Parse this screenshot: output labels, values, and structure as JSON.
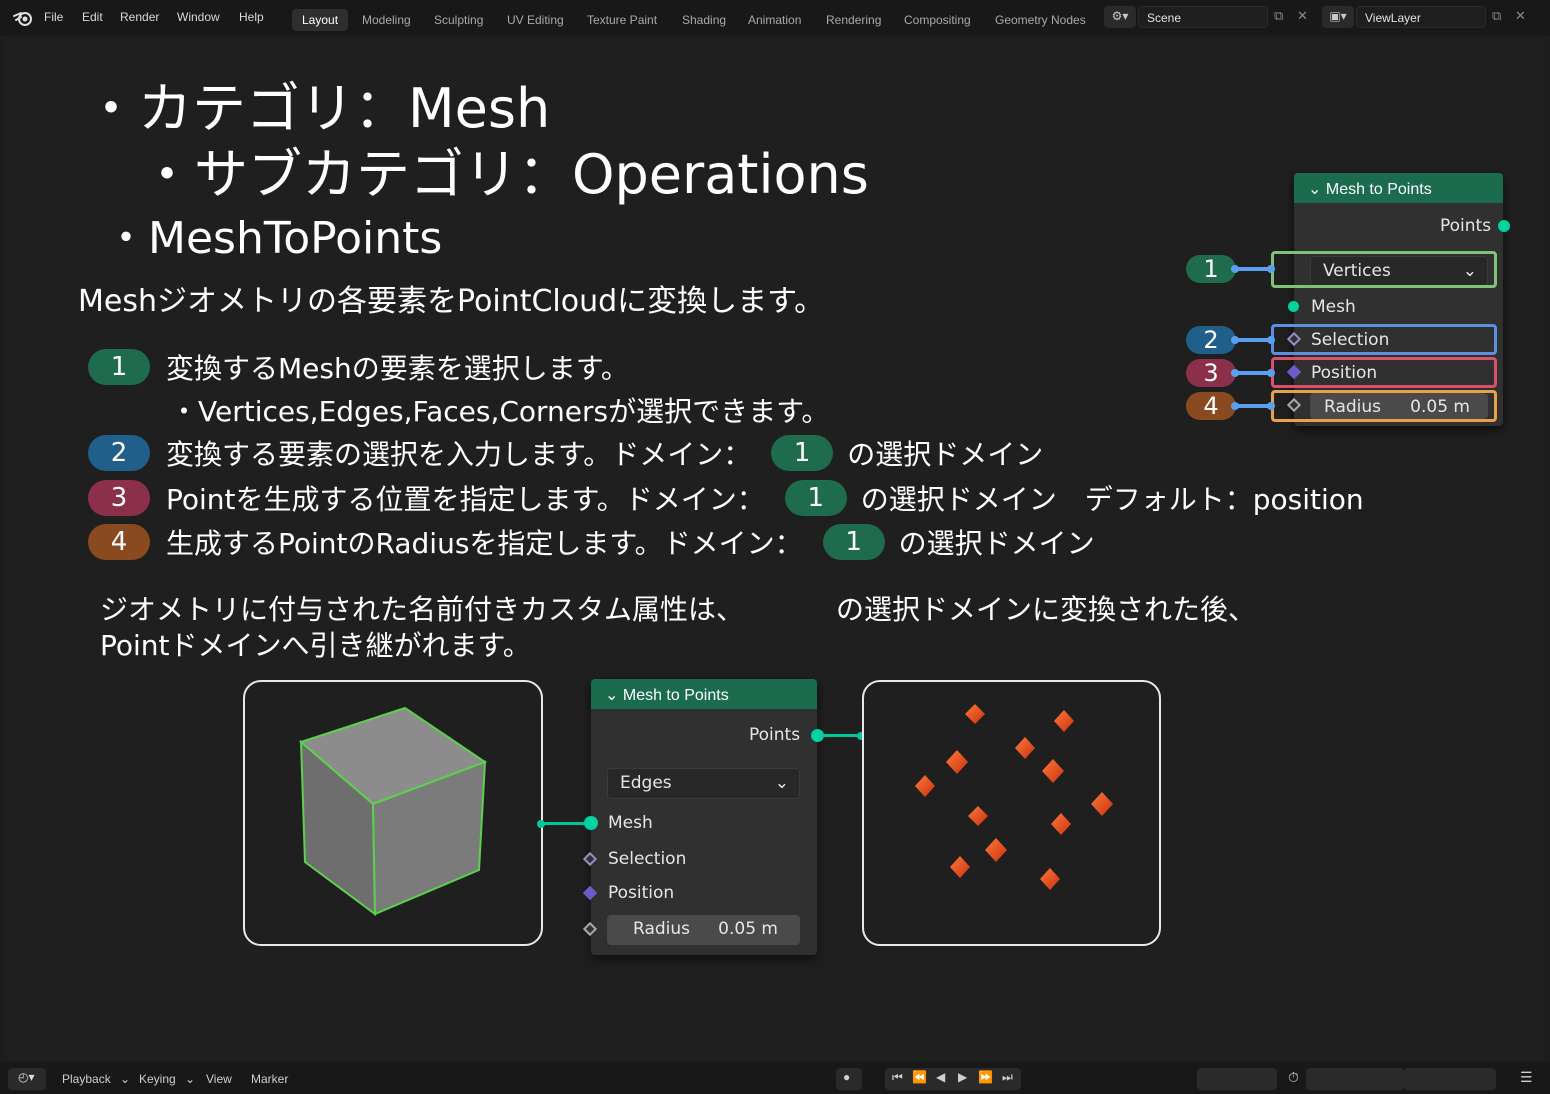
{
  "menu": {
    "items": [
      "File",
      "Edit",
      "Render",
      "Window",
      "Help"
    ]
  },
  "workspaces": {
    "tabs": [
      "Layout",
      "Modeling",
      "Sculpting",
      "UV Editing",
      "Texture Paint",
      "Shading",
      "Animation",
      "Rendering",
      "Compositing",
      "Geometry Nodes"
    ],
    "active": "Layout"
  },
  "scene": {
    "name": "Scene"
  },
  "view_layer": {
    "name": "ViewLayer"
  },
  "slide": {
    "category": "・カテゴリ：Mesh",
    "subcategory": "・サブカテゴリ：Operations",
    "node_name": "・MeshToPoints",
    "description": "Meshジオメトリの各要素をPointCloudに変換します。",
    "items": [
      {
        "num": "1",
        "text": "変換するMeshの要素を選択します。"
      },
      {
        "num": "2",
        "text": "変換する要素の選択を入力します。ドメイン：",
        "ref": "1",
        "suffix": "の選択ドメイン"
      },
      {
        "num": "3",
        "text": "Pointを生成する位置を指定します。ドメイン：",
        "ref": "1",
        "suffix": "の選択ドメイン　デフォルト：position"
      },
      {
        "num": "4",
        "text": "生成するPointのRadiusを指定します。ドメイン：",
        "ref": "1",
        "suffix": "の選択ドメイン"
      }
    ],
    "item1_sub": "・Vertices,Edges,Faces,Cornersが選択できます。",
    "note_line1a": "ジオメトリに付与された名前付きカスタム属性は、",
    "note_line1b": "の選択ドメインに変換された後、",
    "note_line2": "Pointドメインへ引き継がれます。"
  },
  "node_top": {
    "title": "Mesh to Points",
    "output": "Points",
    "mode": "Vertices",
    "inputs": [
      "Mesh",
      "Selection",
      "Position",
      "Radius"
    ],
    "radius_value": "0.05 m",
    "badges": [
      "1",
      "2",
      "3",
      "4"
    ]
  },
  "node_bottom": {
    "title": "Mesh to Points",
    "output": "Points",
    "mode": "Edges",
    "inputs": [
      "Mesh",
      "Selection",
      "Position",
      "Radius"
    ],
    "radius_value": "0.05 m"
  },
  "colors": {
    "badge1": "#1f6b4d",
    "badge2": "#1f5f8a",
    "badge3": "#8c2f4a",
    "badge4": "#8a4a1f",
    "node_header": "#1b6b4e",
    "socket_geometry": "#00d2a0",
    "point": "#e8481c"
  },
  "timeline": {
    "items": [
      "Playback",
      "Keying",
      "View",
      "Marker"
    ]
  }
}
